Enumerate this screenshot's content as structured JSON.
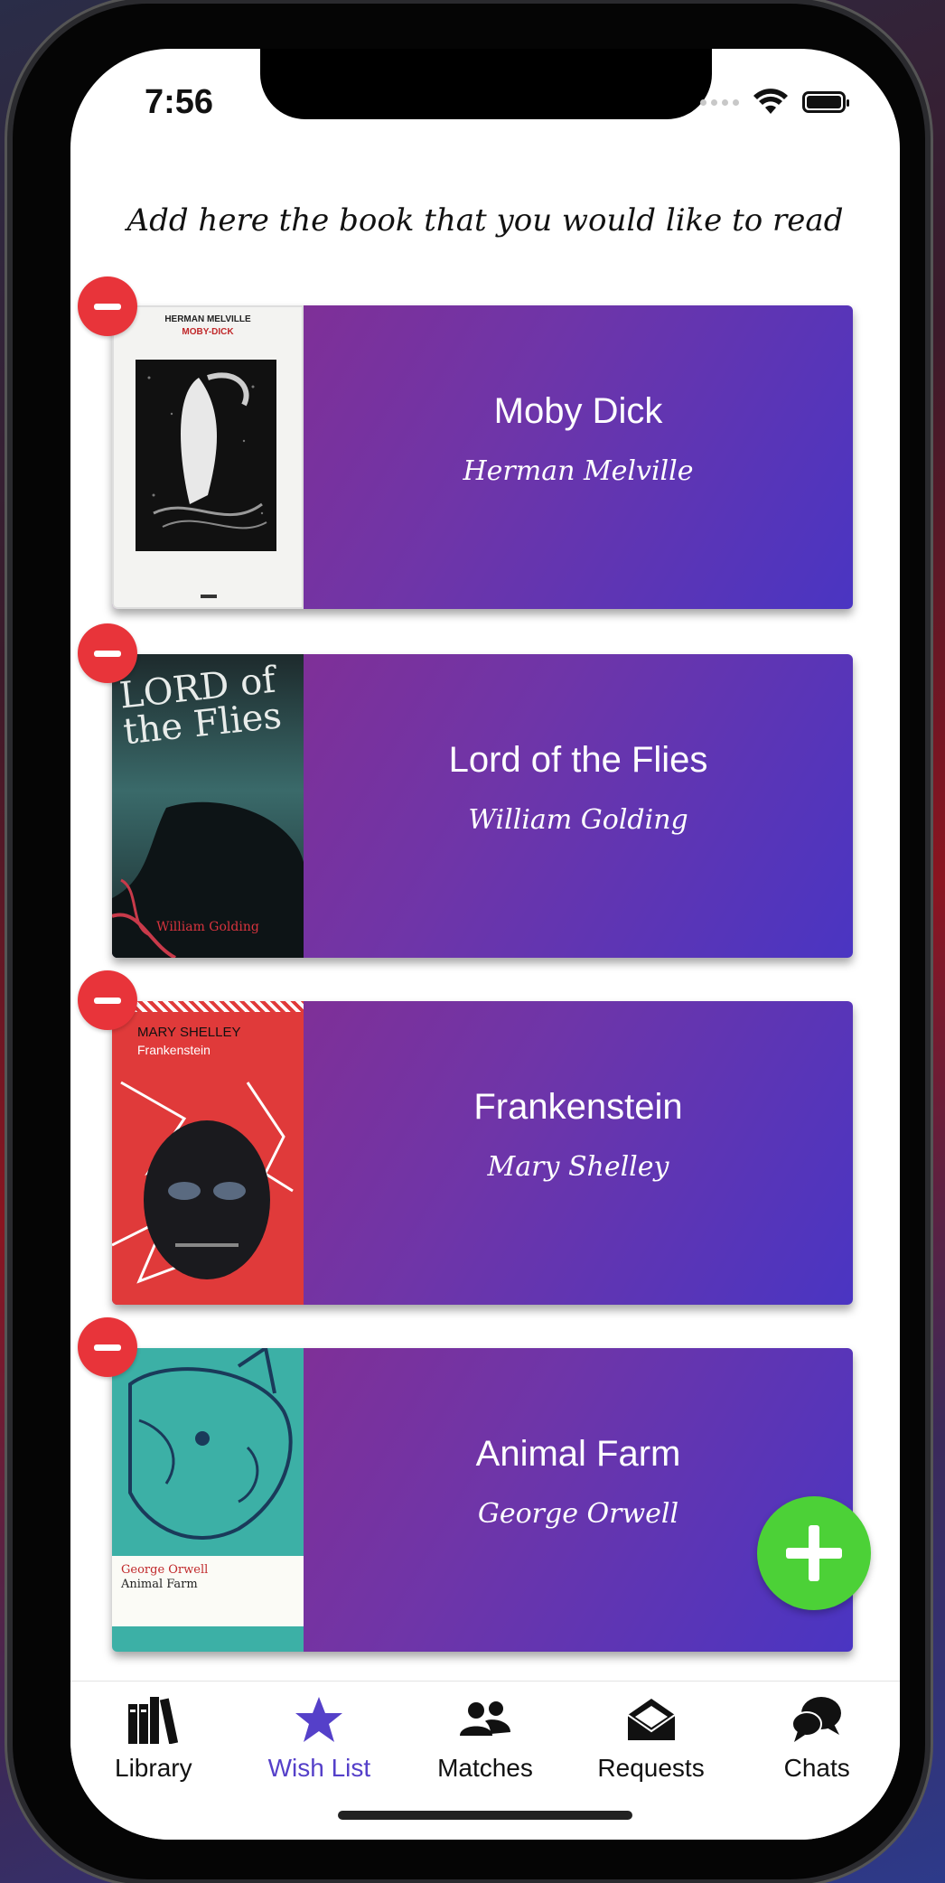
{
  "status_bar": {
    "time": "7:56"
  },
  "header": {
    "subtitle": "Add here the book that you would like to read"
  },
  "books": [
    {
      "title": "Moby Dick",
      "author": "Herman Melville",
      "cover_text_1": "HERMAN MELVILLE",
      "cover_text_2": "MOBY-DICK"
    },
    {
      "title": "Lord of the Flies",
      "author": "William Golding",
      "cover_text_1": "LORD of the Flies",
      "cover_text_2": "William Golding"
    },
    {
      "title": "Frankenstein",
      "author": "Mary Shelley",
      "cover_text_1": "MARY SHELLEY",
      "cover_text_2": "Frankenstein"
    },
    {
      "title": "Animal Farm",
      "author": "George Orwell",
      "cover_text_1": "George Orwell",
      "cover_text_2": "Animal Farm"
    }
  ],
  "tabs": [
    {
      "label": "Library",
      "icon": "library-icon"
    },
    {
      "label": "Wish List",
      "icon": "star-icon",
      "active": true
    },
    {
      "label": "Matches",
      "icon": "people-icon"
    },
    {
      "label": "Requests",
      "icon": "envelope-icon"
    },
    {
      "label": "Chats",
      "icon": "chat-bubbles-icon"
    }
  ],
  "colors": {
    "card_gradient_start": "#8a2c8c",
    "card_gradient_end": "#4a35c2",
    "remove_button": "#e8343a",
    "add_button": "#4cd137",
    "active_tab": "#5540c9"
  }
}
